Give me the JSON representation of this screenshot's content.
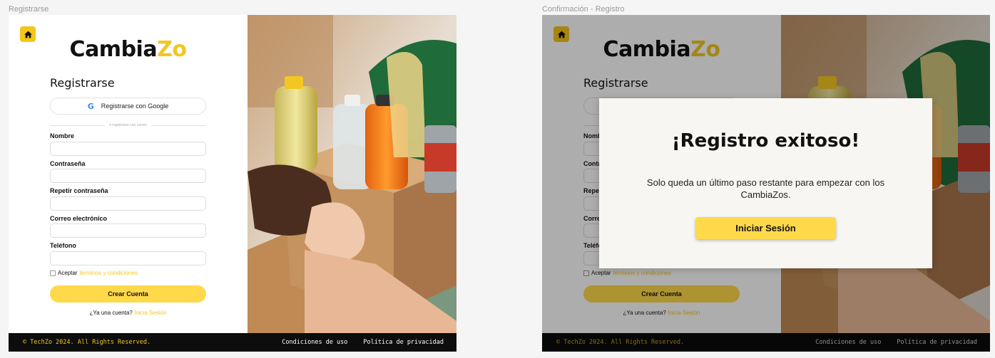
{
  "frames": {
    "register_label": "Registrarse",
    "confirm_label": "Confirmación - Registro"
  },
  "logo": {
    "part1": "Cambia",
    "part2": "Zo"
  },
  "form": {
    "title": "Registrarse",
    "google_button": "Registrarse con Google",
    "google_letter": "G",
    "divider_text": "o registrarse con correo",
    "fields": [
      {
        "label": "Nombre",
        "value": ""
      },
      {
        "label": "Contraseña",
        "value": ""
      },
      {
        "label": "Repetir contraseña",
        "value": ""
      },
      {
        "label": "Correo electrónico",
        "value": ""
      },
      {
        "label": "Teléfono",
        "value": ""
      }
    ],
    "terms_prefix": "Aceptar",
    "terms_link": "términos y condiciones",
    "create_button": "Crear Cuenta",
    "login_prompt": "¿Ya una cuenta?",
    "login_link": "Inicia Sesión"
  },
  "footer": {
    "copyright": "© TechZo 2024. All Rights Reserved.",
    "terms": "Condiciones de uso",
    "privacy": "Política de privacidad"
  },
  "modal": {
    "title": "¡Registro exitoso!",
    "message": "Solo queda un último paso restante para empezar con los CambiaZos.",
    "button": "Iniciar Sesión"
  },
  "colors": {
    "accent": "#f3c623",
    "button": "#ffd94a",
    "footer_bg": "#0d0d0d",
    "modal_bg": "#f7f6f2"
  },
  "icons": {
    "home": "home-icon",
    "google": "google-icon"
  }
}
